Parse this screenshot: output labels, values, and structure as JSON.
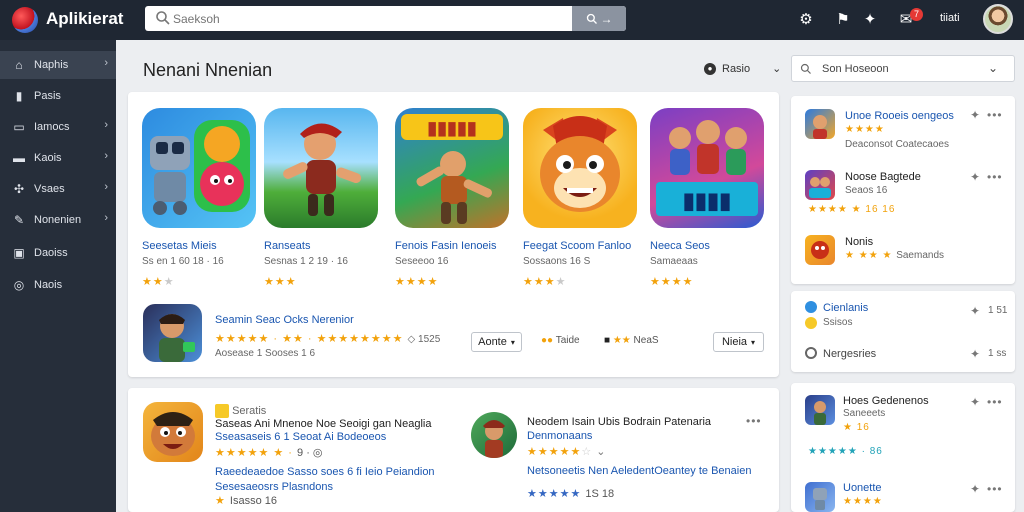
{
  "app": {
    "title": "Aplikierat"
  },
  "search": {
    "placeholder": "Saeksoh",
    "button_label": "→"
  },
  "topbar": {
    "notification_count": "7",
    "user_label": "tiiati"
  },
  "sidebar": {
    "items": [
      {
        "label": "Naphis",
        "icon": "home-icon",
        "chevron": true,
        "active": true
      },
      {
        "label": "Pasis",
        "icon": "bookmark-icon",
        "chevron": false
      },
      {
        "label": "Iamocs",
        "icon": "monitor-icon",
        "chevron": true
      },
      {
        "label": "Kaois",
        "icon": "file-icon",
        "chevron": true
      },
      {
        "label": "Vsaes",
        "icon": "people-icon",
        "chevron": true
      },
      {
        "label": "Nonenien",
        "icon": "tools-icon",
        "chevron": true
      },
      {
        "label": "Daoiss",
        "icon": "chat-icon",
        "chevron": false
      },
      {
        "label": "Naois",
        "icon": "settings-icon",
        "chevron": false
      }
    ]
  },
  "main": {
    "section_title": "Nenani Nnenian",
    "sort_label": "Rasio",
    "tiles": [
      {
        "name": "Seesetas Mieis",
        "meta": "Ss en 1 60 18 · 16",
        "stars": "★★",
        "off": "★"
      },
      {
        "name": "Ranseats",
        "meta": "Sesnas 1 2 19 · 16",
        "stars": "★★★",
        "off": ""
      },
      {
        "name": "Fenois Fasin Ienoeis",
        "meta": "Seseeoo 16",
        "stars": "★★★★",
        "off": ""
      },
      {
        "name": "Feegat Scoom Fanloo",
        "meta": "Sossaons 16 S",
        "stars": "★★★",
        "off": "★"
      },
      {
        "name": "Neeca Seos",
        "meta": "Samaeaas",
        "stars": "★★★★",
        "off": ""
      }
    ],
    "featured": {
      "name": "Seamin Seac Ocks Nerenior",
      "rating_text": "★★★★★ · ★★ · ★★★★★★★★",
      "count": "◇ 1525",
      "meta": "Aosease 1 Sooses 1 6",
      "mini1": "Taide",
      "mini2": "NeaS",
      "button1": "Aonte",
      "button2": "Nieia"
    },
    "list": [
      {
        "tag": "Seratis",
        "title": "Saseas Ani Mnenoe Noe Seoigi gan Neaglia",
        "sub": "Sseasaseis 6 1 Seoat Ai Bodeoeos",
        "rating_text": "★★★★★ ★ ·",
        "count": "9 · ◎",
        "desc": "Raeedeaedoe Sasso soes 6 fi Ieio Peiandion",
        "desc2": "Sesesaeosrs Plasndons",
        "foot": "Isasso 16"
      },
      {
        "title": "Neodem Isain Ubis Bodrain Patenaria",
        "sub": "Denmonaans",
        "rating_text": "★★★★★",
        "off": "☆",
        "desc": "Netsoneetis Nen AeledentOeantey te Benaien",
        "rating2": "★★★★★",
        "count2": "1S 18"
      }
    ]
  },
  "right_panel": {
    "select_label": "Son Hoseoon",
    "panel1": [
      {
        "name": "Unoe Rooeis oengeos",
        "stars": "★★★★",
        "sub": "Deaconsot Coatecaoes"
      },
      {
        "name": "Noose Bagtede",
        "stars": "",
        "sub": "Seaos 16"
      },
      {
        "name": "Nonis",
        "stars": "★ ★★ ★",
        "sub": "Saemands"
      }
    ],
    "panel1_extra": {
      "row2_stars": "★★★★ ★ 16 16"
    },
    "panel2": [
      {
        "name": "Cienlanis",
        "sub": "Ssisos",
        "count": "1 51"
      },
      {
        "name": "Nergesries",
        "count": "1 ss"
      }
    ],
    "panel3": [
      {
        "name": "Hoes Gedenenos",
        "sub": "Saneeets",
        "stars": "★ 16",
        "stars2": "★★★★★ · 86"
      },
      {
        "name": "Uonette",
        "stars": "★★★★"
      }
    ]
  }
}
